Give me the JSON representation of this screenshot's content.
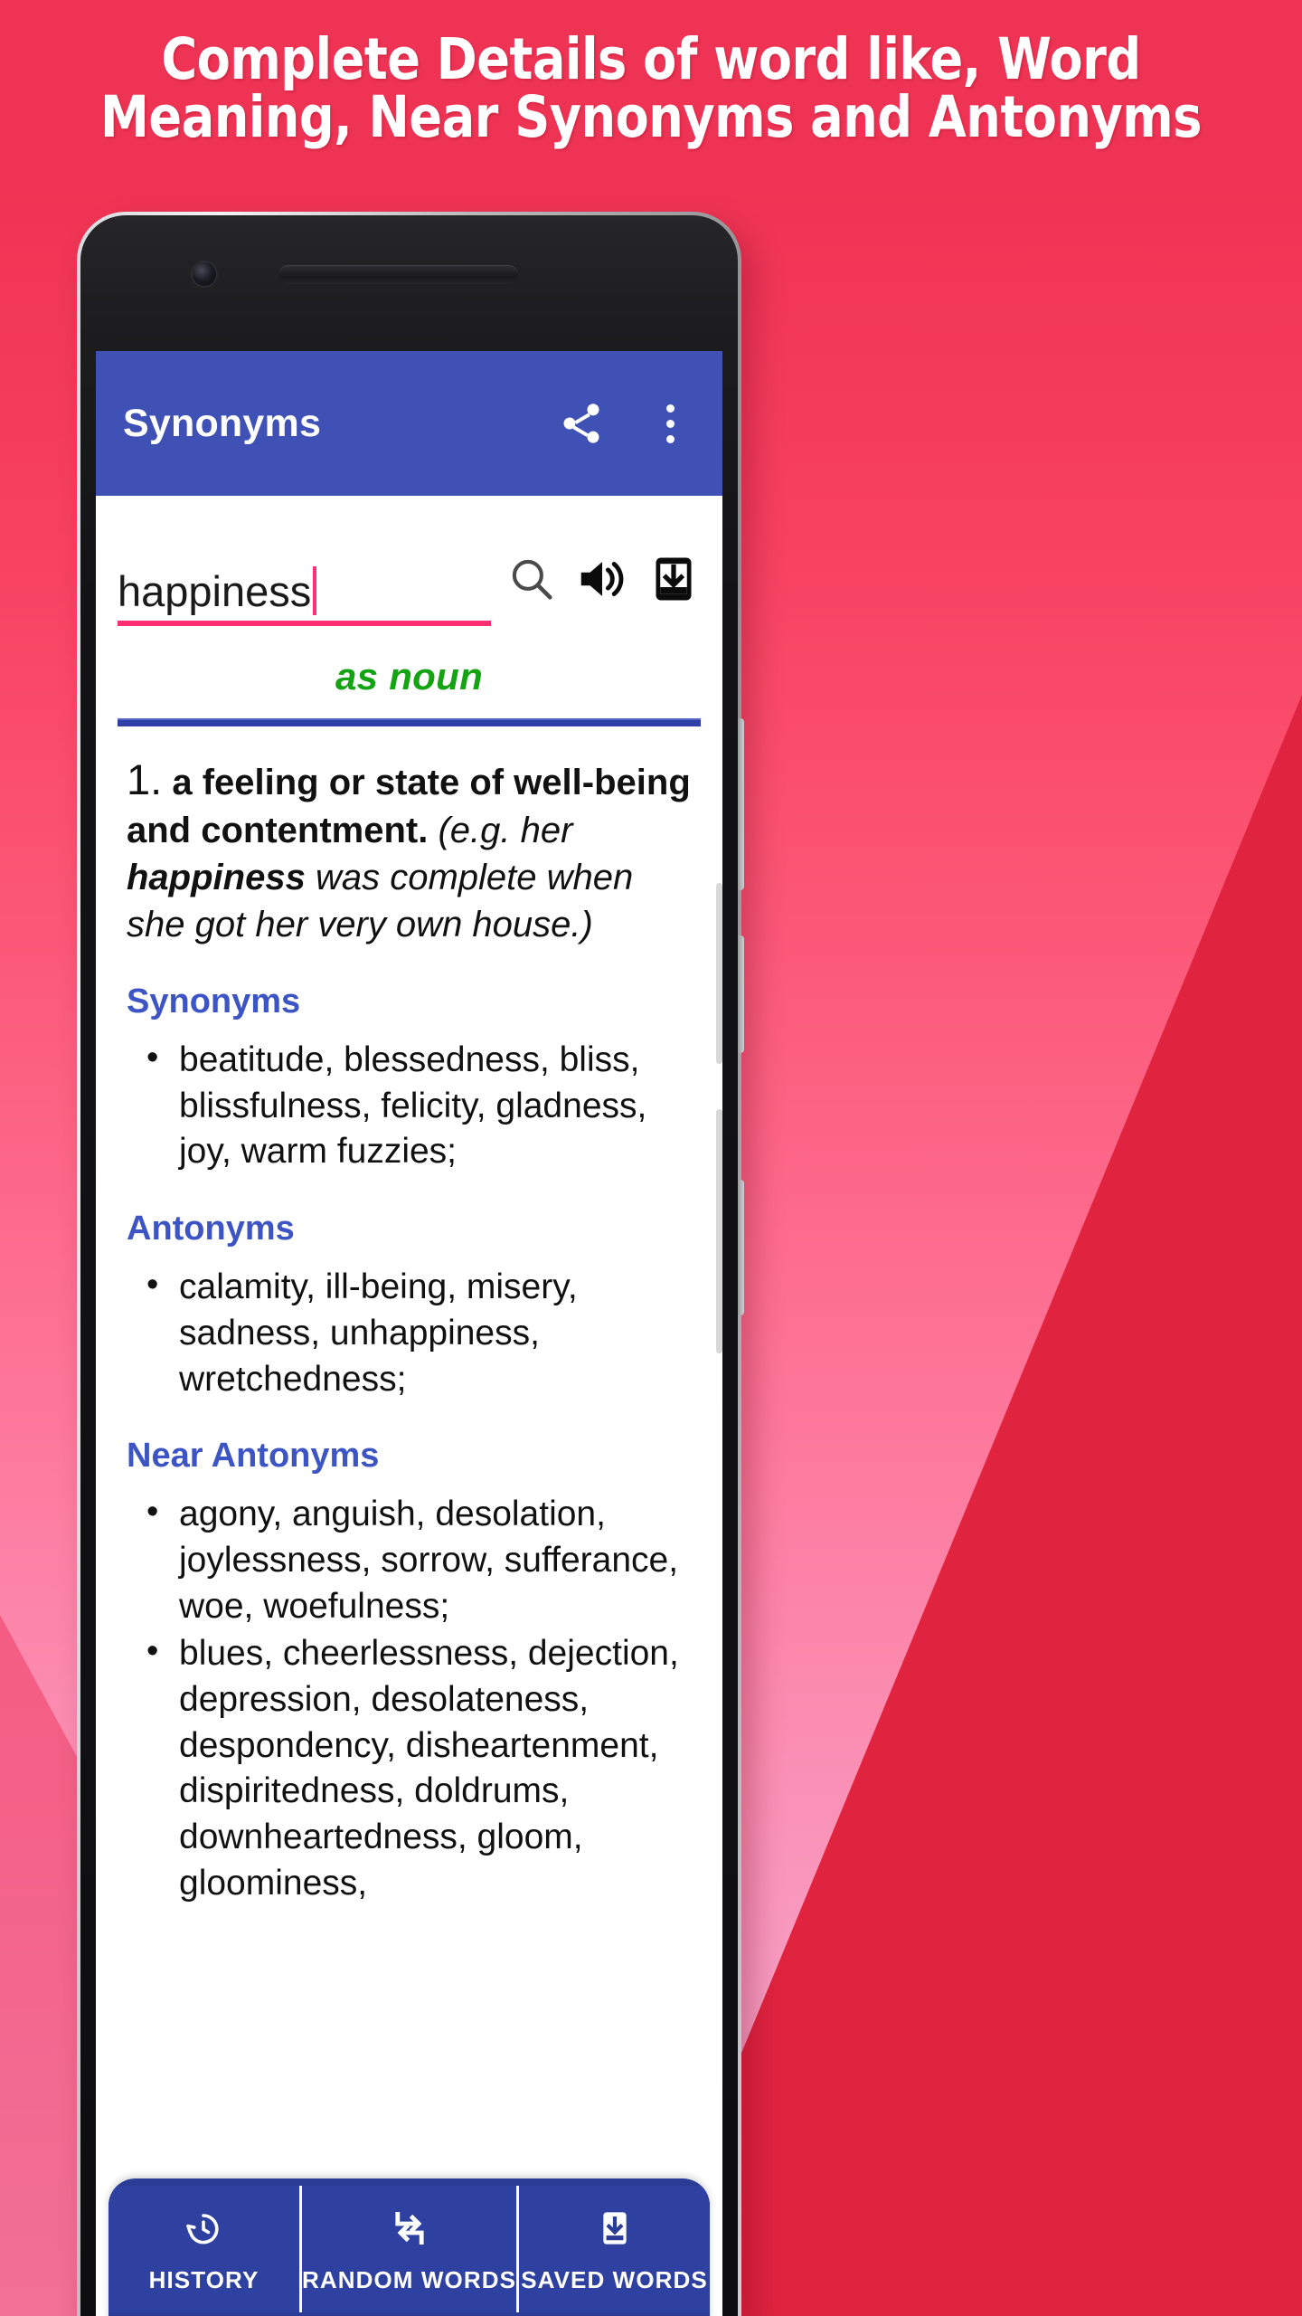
{
  "promo": {
    "headline_line1": "Complete Details of word like, Word",
    "headline_line2": "Meaning, Near Synonyms and Antonyms",
    "colors": {
      "background_top": "#ef3354",
      "background_bottom": "#f6b0d4",
      "wedge_red": "#e0233f",
      "app_bar_blue": "#3f51b5",
      "accent_pink": "#ff2e73",
      "section_heading_blue": "#3d55c4",
      "pos_green": "#13a313",
      "bottom_nav_blue": "#2b3c96"
    }
  },
  "app": {
    "appbar": {
      "title": "Synonyms",
      "share_icon": "share-icon",
      "overflow_icon": "more-vert-icon"
    },
    "search": {
      "value": "happiness",
      "placeholder": "happiness",
      "search_icon": "search-icon",
      "speak_icon": "volume-up-icon",
      "save_icon": "save-to-device-icon"
    },
    "entry": {
      "part_of_speech": "as noun",
      "sense_number": "1.",
      "definition": "a feeling or state of well-being and contentment.",
      "example_prefix": "(e.g. her ",
      "example_bold": "happiness",
      "example_suffix": " was complete when she got her very own house.)",
      "sections": [
        {
          "title": "Synonyms",
          "items": [
            "beatitude, blessedness, bliss, blissfulness, felicity, gladness, joy, warm fuzzies;"
          ]
        },
        {
          "title": "Antonyms",
          "items": [
            "calamity, ill-being, misery, sadness, unhappiness, wretchedness;"
          ]
        },
        {
          "title": "Near Antonyms",
          "items": [
            "agony, anguish, desolation, joylessness, sorrow, sufferance, woe, woefulness;",
            "blues, cheerlessness, dejection, depression, desolateness, despondency, disheartenment, dispiritedness, doldrums, downheartedness, gloom, gloominess,"
          ]
        }
      ]
    },
    "bottom_nav": [
      {
        "label": "HISTORY",
        "icon": "history-icon"
      },
      {
        "label": "RANDOM WORDS",
        "icon": "shuffle-repeat-icon"
      },
      {
        "label": "SAVED WORDS",
        "icon": "save-to-device-icon"
      }
    ]
  }
}
